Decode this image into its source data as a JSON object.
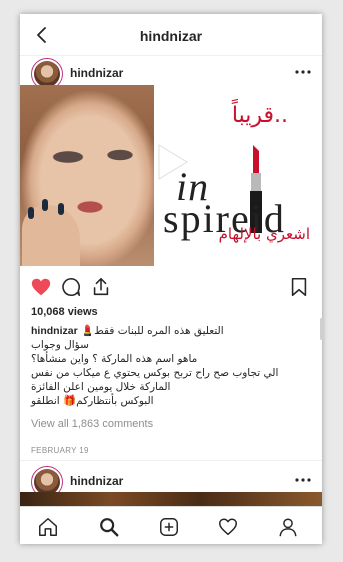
{
  "topbar": {
    "title": "hindnizar",
    "back_icon": "chevron-left-icon"
  },
  "post1": {
    "username": "hindnizar",
    "ad": {
      "arabic_top": "قريباً..",
      "brand_line1": "in",
      "brand_line2": "spireid",
      "arabic_bottom": "اشعري بالإلهام"
    },
    "views": "10,068 views",
    "caption_user": "hindnizar",
    "caption_lines": [
      "💄التعليق هذه المره للبنات فقط",
      "سؤال وجواب",
      "ماهو اسم هذه الماركة ؟ واين منشأها؟",
      "الي تجاوب صح راح تربح بوكس يحتوي ع ميكاب من نفس",
      "الماركة خلال يومين اعلن الفائزة",
      "البوكس بأنتظاركم🎁 انطلقو"
    ],
    "view_comments": "View all 1,863 comments",
    "date": "FEBRUARY 19"
  },
  "post2": {
    "username": "hindnizar"
  },
  "colors": {
    "like": "#ed4956",
    "ad_red": "#c8102e",
    "avatar_ring": "#c13584",
    "muted": "#8e8e8e"
  },
  "tabs": [
    "home-icon",
    "search-icon",
    "new-post-icon",
    "activity-heart-icon",
    "profile-icon"
  ]
}
